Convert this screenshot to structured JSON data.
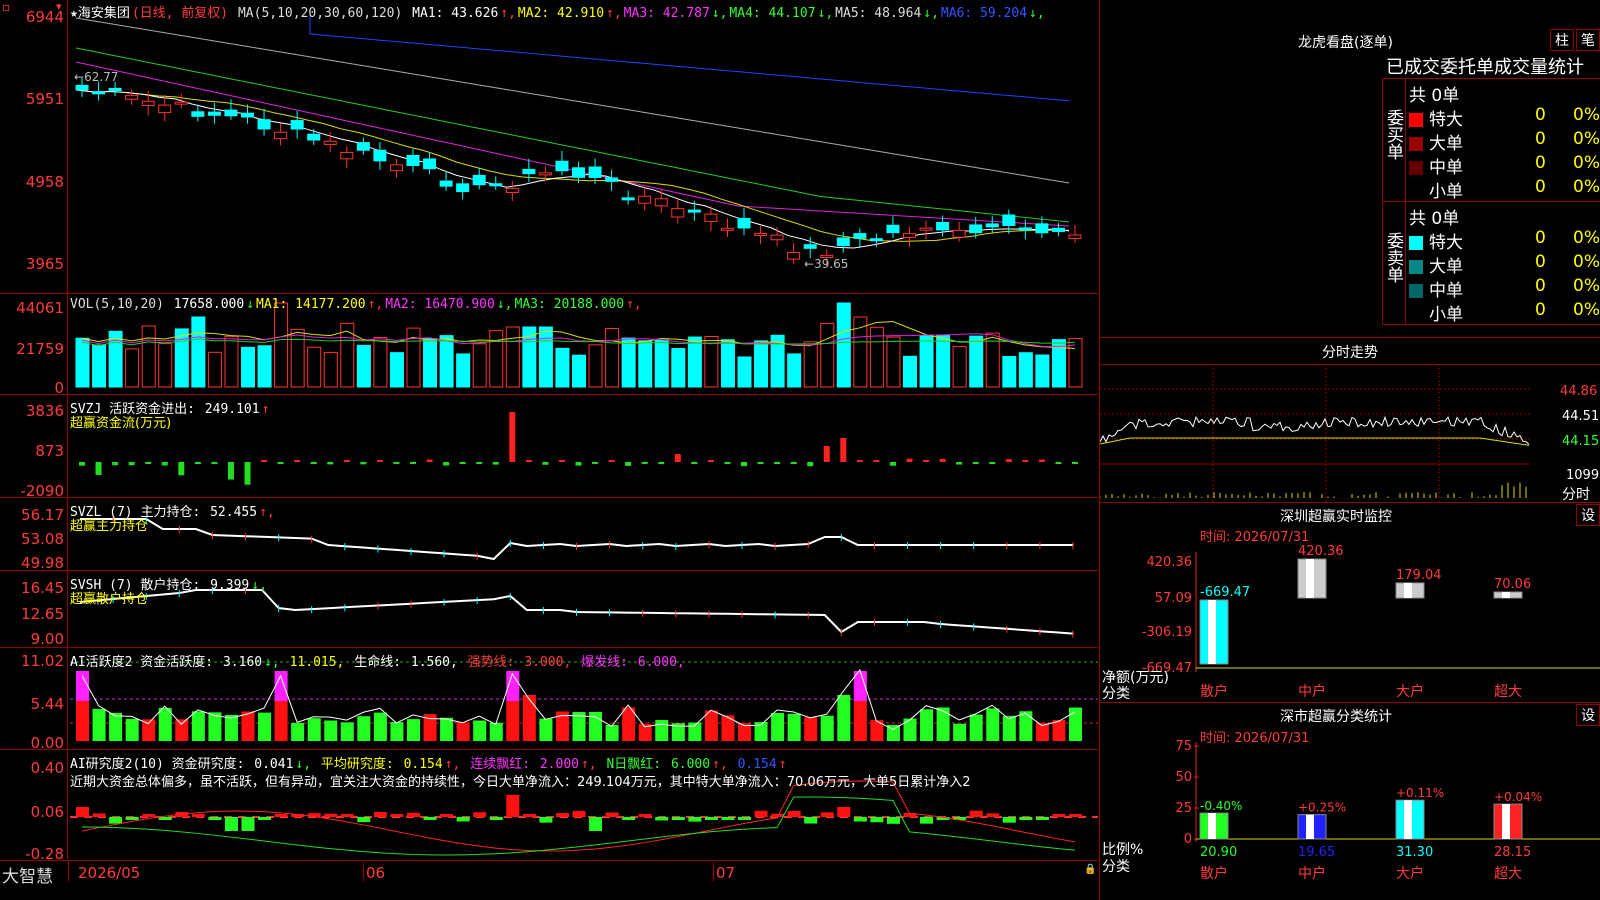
{
  "main": {
    "title": "★海安集团",
    "period": "(日线, 前复权)",
    "ma_params": "MA(5,10,20,30,60,120)",
    "ma": [
      {
        "label": "MA1:",
        "value": "43.626",
        "arrow": "↑",
        "color": "#ffffff"
      },
      {
        "label": "MA2:",
        "value": "42.910",
        "arrow": "↑",
        "color": "#ffff00"
      },
      {
        "label": "MA3:",
        "value": "42.787",
        "arrow": "↓",
        "color": "#ff33ff"
      },
      {
        "label": "MA4:",
        "value": "44.107",
        "arrow": "↓",
        "color": "#33ff33"
      },
      {
        "label": "MA5:",
        "value": "48.964",
        "arrow": "↓",
        "color": "#dddddd"
      },
      {
        "label": "MA6:",
        "value": "59.204",
        "arrow": "↓",
        "color": "#3355ff"
      }
    ],
    "y_ticks": [
      "6944",
      "5951",
      "4958",
      "3965"
    ],
    "high_mark": "62.77",
    "low_mark": "39.65"
  },
  "vol": {
    "header": "VOL(5,10,20)",
    "value": "17658.000",
    "arrow": "↓",
    "ma": [
      {
        "label": "MA1:",
        "value": "14177.200",
        "arrow": "↑",
        "color": "#ffff00"
      },
      {
        "label": "MA2:",
        "value": "16470.900",
        "arrow": "↓",
        "color": "#ff33ff"
      },
      {
        "label": "MA3:",
        "value": "20188.000",
        "arrow": "↑",
        "color": "#33ff33"
      }
    ],
    "y_ticks": [
      "44061",
      "21759",
      "0"
    ]
  },
  "svzj": {
    "header": "SVZJ  活跃资金进出:",
    "value": "249.101",
    "arrow": "↑",
    "sub": "超赢资金流(万元)",
    "y_ticks": [
      "3836",
      "873",
      "-2090"
    ]
  },
  "svzl": {
    "header": "SVZL (7) 主力持仓:",
    "value": "52.455",
    "arrow": "↑,",
    "sub": "超赢主力持仓",
    "y_ticks": [
      "56.17",
      "53.08",
      "49.98"
    ]
  },
  "svsh": {
    "header": "SVSH (7) 散户持仓:",
    "value": "9.399",
    "arrow": "↓,",
    "sub": "超赢散户持仓",
    "y_ticks": [
      "16.45",
      "12.65",
      "9.00"
    ]
  },
  "ai1": {
    "header": "AI活跃度2 资金活跃度:",
    "v1": "3.160",
    "a1": "↓,",
    "v2": "11.015,",
    "life": "生命线:",
    "v3": "1.560,",
    "strong": "强势线:",
    "v4": "3.000,",
    "burst": "爆发线:",
    "v5": "6.000,",
    "y_ticks": [
      "11.02",
      "5.44",
      "0.00"
    ]
  },
  "ai2": {
    "header": "AI研究度2(10) 资金研究度:",
    "v1": "0.041",
    "a1": "↓,",
    "avg": "平均研究度:",
    "v2": "0.154",
    "a2": "↑,",
    "cont": "连续飘红:",
    "v3": "2.000",
    "a3": "↑,",
    "nday": "N日飘红:",
    "v4": "6.000",
    "a4": "↑,",
    "v5": "0.154",
    "a5": "↑",
    "comment": "近期大资金总体偏多，虽不活跃，但有异动，宜关注大资金的持续性，今日大单净流入：249.104万元，其中特大单净流入：70.06万元，大单5日累计净入2",
    "y_ticks": [
      "0.40",
      "0.06",
      "-0.28"
    ]
  },
  "xaxis": {
    "labels": [
      "2026/05",
      "06",
      "07"
    ],
    "brand": "大智慧"
  },
  "right": {
    "lhb_title": "龙虎看盘(逐单)",
    "tab1": "柱",
    "tab2": "笔",
    "stats_title": "已成交委托单成交量统计",
    "buy_label": "委买单",
    "sell_label": "委卖单",
    "buy_total": "共 0单",
    "sell_total": "共 0单",
    "buy_rows": [
      {
        "name": "特大",
        "count": "0",
        "pct": "0%",
        "color": "#ff0000"
      },
      {
        "name": "大单",
        "count": "0",
        "pct": "0%",
        "color": "#990000"
      },
      {
        "name": "中单",
        "count": "0",
        "pct": "0%",
        "color": "#660000"
      },
      {
        "name": "小单",
        "count": "0",
        "pct": "0%",
        "color": ""
      }
    ],
    "sell_rows": [
      {
        "name": "特大",
        "count": "0",
        "pct": "0%",
        "color": "#00ffff"
      },
      {
        "name": "大单",
        "count": "0",
        "pct": "0%",
        "color": "#008888"
      },
      {
        "name": "中单",
        "count": "0",
        "pct": "0%",
        "color": "#006666"
      },
      {
        "name": "小单",
        "count": "0",
        "pct": "0%",
        "color": ""
      }
    ],
    "fs_title": "分时走势",
    "fs_ticks": [
      "44.86",
      "44.51",
      "44.15"
    ],
    "fs_vol": "1099",
    "fs_label": "分时",
    "monitor_title": "深圳超赢实时监控",
    "monitor_set": "设",
    "monitor_time": "时间: 2026/07/31",
    "monitor_ticks": [
      "420.36",
      "57.09",
      "-306.19",
      "-669.47"
    ],
    "monitor_bars": [
      {
        "name": "散户",
        "value": -669.47,
        "label": "-669.47"
      },
      {
        "name": "中户",
        "value": 420.36,
        "label": "420.36"
      },
      {
        "name": "大户",
        "value": 179.04,
        "label": "179.04"
      },
      {
        "name": "超大",
        "value": 70.06,
        "label": "70.06"
      }
    ],
    "monitor_unit1": "净额(万元)",
    "monitor_unit2": "分类",
    "class_title": "深市超赢分类统计",
    "class_set": "设",
    "class_time": "时间: 2026/07/31",
    "class_ticks": [
      "75",
      "50",
      "25",
      "0"
    ],
    "class_bars": [
      {
        "name": "散户",
        "value": 20.9,
        "label": "20.90",
        "change": "-0.40%"
      },
      {
        "name": "中户",
        "value": 19.65,
        "label": "19.65",
        "change": "+0.25%"
      },
      {
        "name": "大户",
        "value": 31.3,
        "label": "31.30",
        "change": "+0.11%"
      },
      {
        "name": "超大",
        "value": 28.15,
        "label": "28.15",
        "change": "+0.04%"
      }
    ],
    "class_unit1": "比例%",
    "class_unit2": "分类"
  }
}
